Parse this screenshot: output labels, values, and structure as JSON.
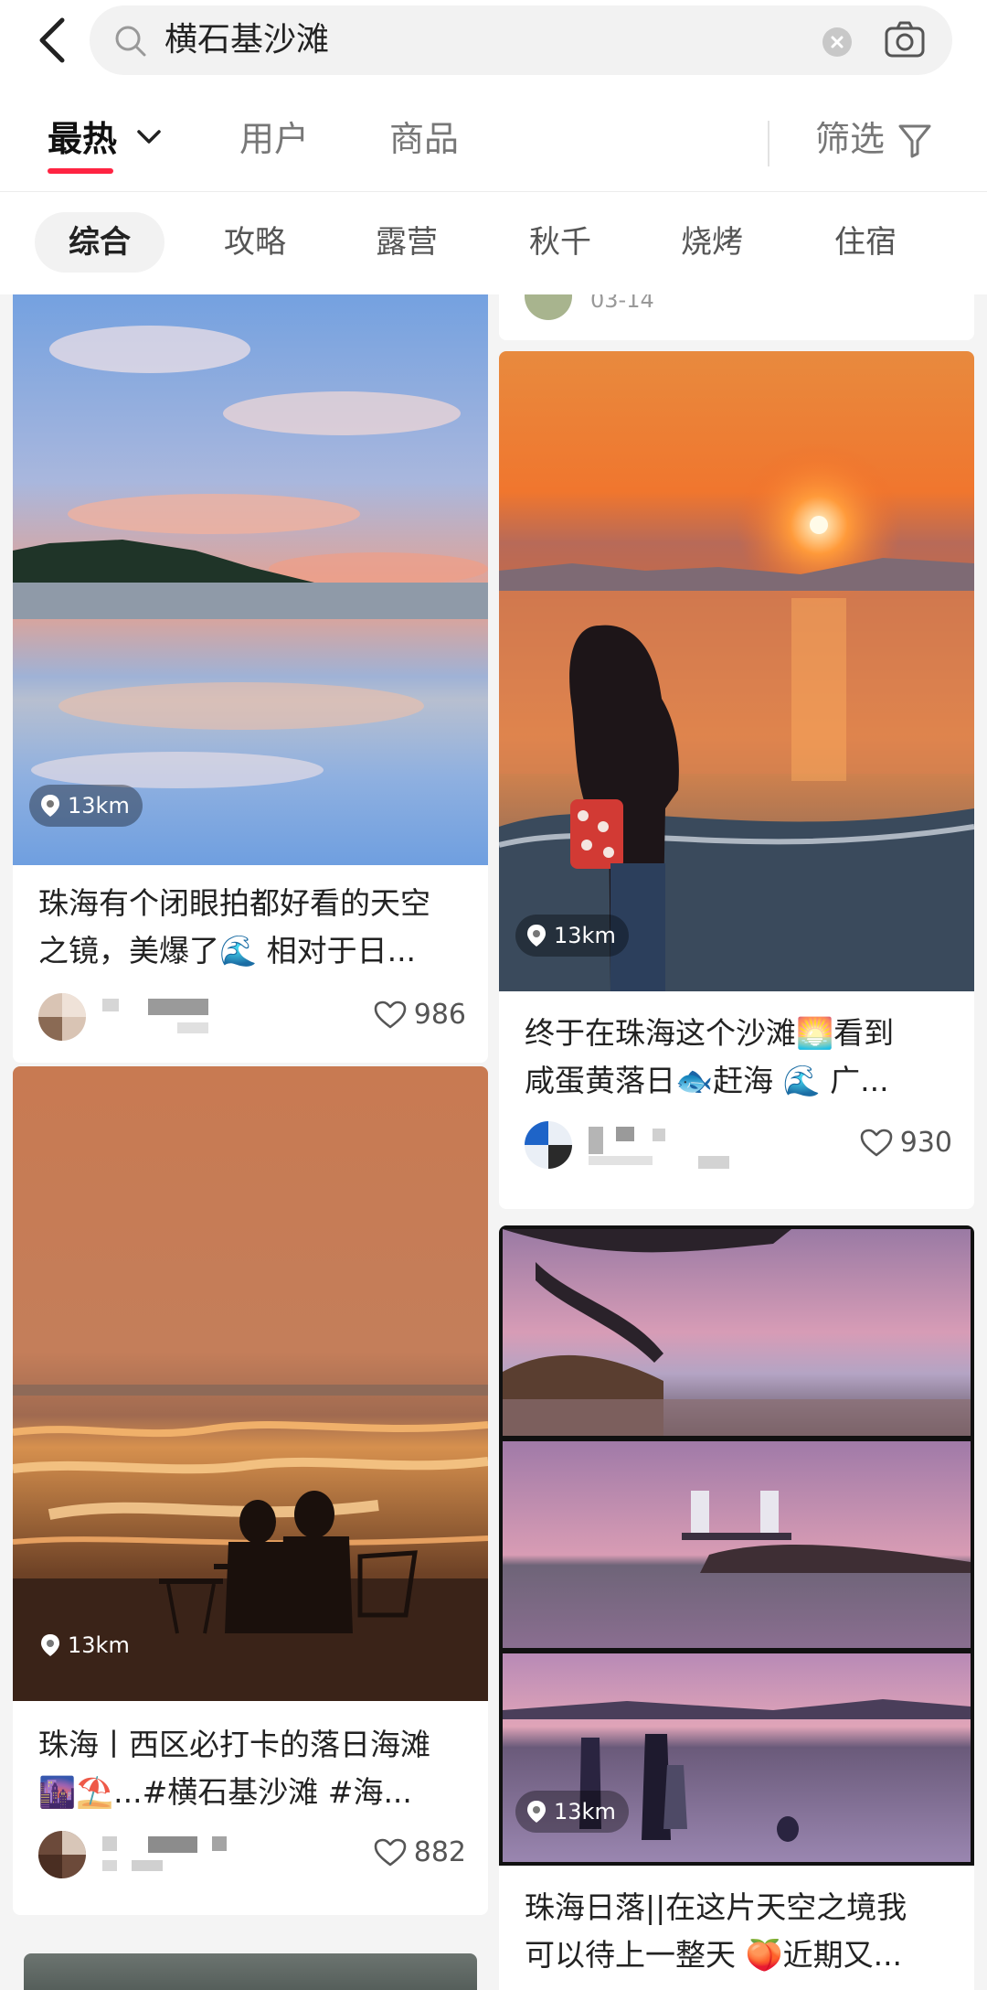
{
  "search": {
    "query": "横石基沙滩"
  },
  "tabs": [
    {
      "label": "最热"
    },
    {
      "label": "用户"
    },
    {
      "label": "商品"
    }
  ],
  "filter": {
    "label": "筛选"
  },
  "chips": [
    {
      "label": "综合"
    },
    {
      "label": "攻略"
    },
    {
      "label": "露营"
    },
    {
      "label": "秋千"
    },
    {
      "label": "烧烤"
    },
    {
      "label": "住宿"
    }
  ],
  "top_right_partial": {
    "date": "03-14"
  },
  "cards": [
    {
      "distance": "13km",
      "title_line1": "珠海有个闭眼拍都好看的天空",
      "title_line2": "之镜，美爆了🌊 相对于日...",
      "likes": "986"
    },
    {
      "distance": "13km",
      "title_line1": "终于在珠海这个沙滩🌅看到",
      "title_line2": "咸蛋黄落日🐟赶海 🌊 广...",
      "likes": "930"
    },
    {
      "distance": "13km",
      "title_line1": "珠海丨西区必打卡的落日海滩",
      "title_line2": "🌆⛱️...#横石基沙滩 #海...",
      "likes": "882"
    },
    {
      "distance": "13km",
      "title_line1": "珠海日落||在这片天空之境我",
      "title_line2": "可以待上一整天 🍑近期又..."
    }
  ],
  "colors": {
    "accent": "#ff2442"
  }
}
